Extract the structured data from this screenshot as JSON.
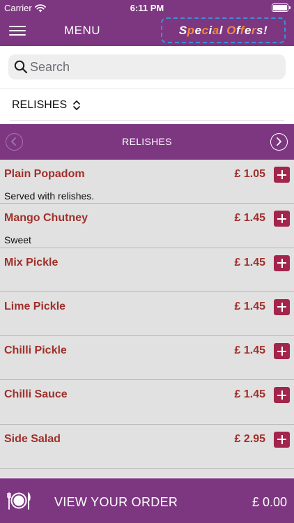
{
  "status_bar": {
    "carrier": "Carrier",
    "time": "6:11 PM"
  },
  "nav": {
    "title": "MENU",
    "special_offers": {
      "text": "Special Offers!",
      "letter_colors": [
        "#ffffff",
        "#f08a3a",
        "#ffffff",
        "#f08a3a",
        "#ffffff",
        "#f08a3a",
        "#ffffff",
        "#ffffff",
        "#f08a3a",
        "#ffffff",
        "#f08a3a",
        "#ffffff",
        "#f08a3a",
        "#ffffff",
        "#ffffff"
      ]
    }
  },
  "search": {
    "placeholder": "Search",
    "value": ""
  },
  "category_picker": {
    "selected": "RELISHES",
    "icon": "sort-updown-icon"
  },
  "section": {
    "title": "RELISHES"
  },
  "menu_items": [
    {
      "name": "Plain Popadom",
      "price": "£ 1.05",
      "description": "Served with relishes."
    },
    {
      "name": "Mango Chutney",
      "price": "£ 1.45",
      "description": "Sweet"
    },
    {
      "name": "Mix Pickle",
      "price": "£ 1.45",
      "description": ""
    },
    {
      "name": "Lime Pickle",
      "price": "£ 1.45",
      "description": ""
    },
    {
      "name": "Chilli Pickle",
      "price": "£ 1.45",
      "description": ""
    },
    {
      "name": "Chilli Sauce",
      "price": "£ 1.45",
      "description": ""
    },
    {
      "name": "Side Salad",
      "price": "£ 2.95",
      "description": ""
    }
  ],
  "order_bar": {
    "label": "VIEW YOUR ORDER",
    "total": "£ 0.00"
  },
  "colors": {
    "brand_purple": "#7d3781",
    "price_red": "#a02f2a",
    "add_button": "#a3254c",
    "list_background": "#e1e1e1"
  }
}
